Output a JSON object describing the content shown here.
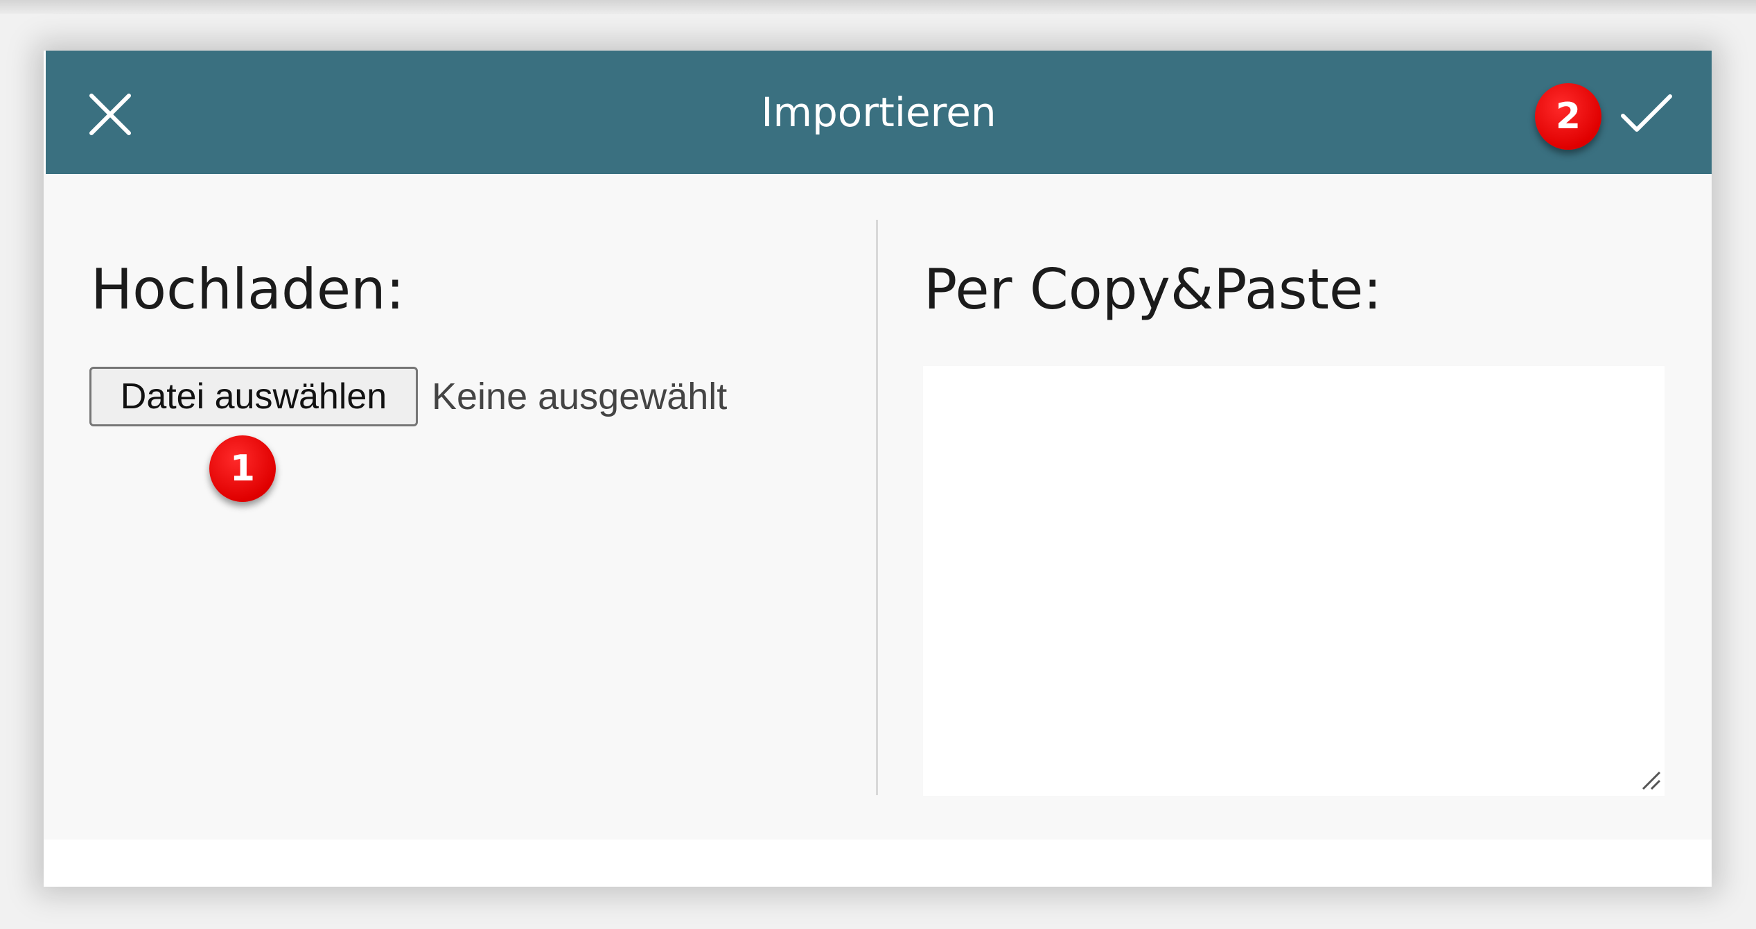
{
  "dialog": {
    "title": "Importieren",
    "close_icon": "close-icon",
    "confirm_icon": "checkmark-icon",
    "header_color": "#3a7080"
  },
  "upload": {
    "heading": "Hochladen:",
    "button_label": "Datei auswählen",
    "file_status": "Keine ausgewählt"
  },
  "paste": {
    "heading": "Per Copy&Paste:",
    "textarea_value": ""
  },
  "annotations": {
    "step_1": "1",
    "step_2": "2",
    "badge_color": "#e00000"
  }
}
